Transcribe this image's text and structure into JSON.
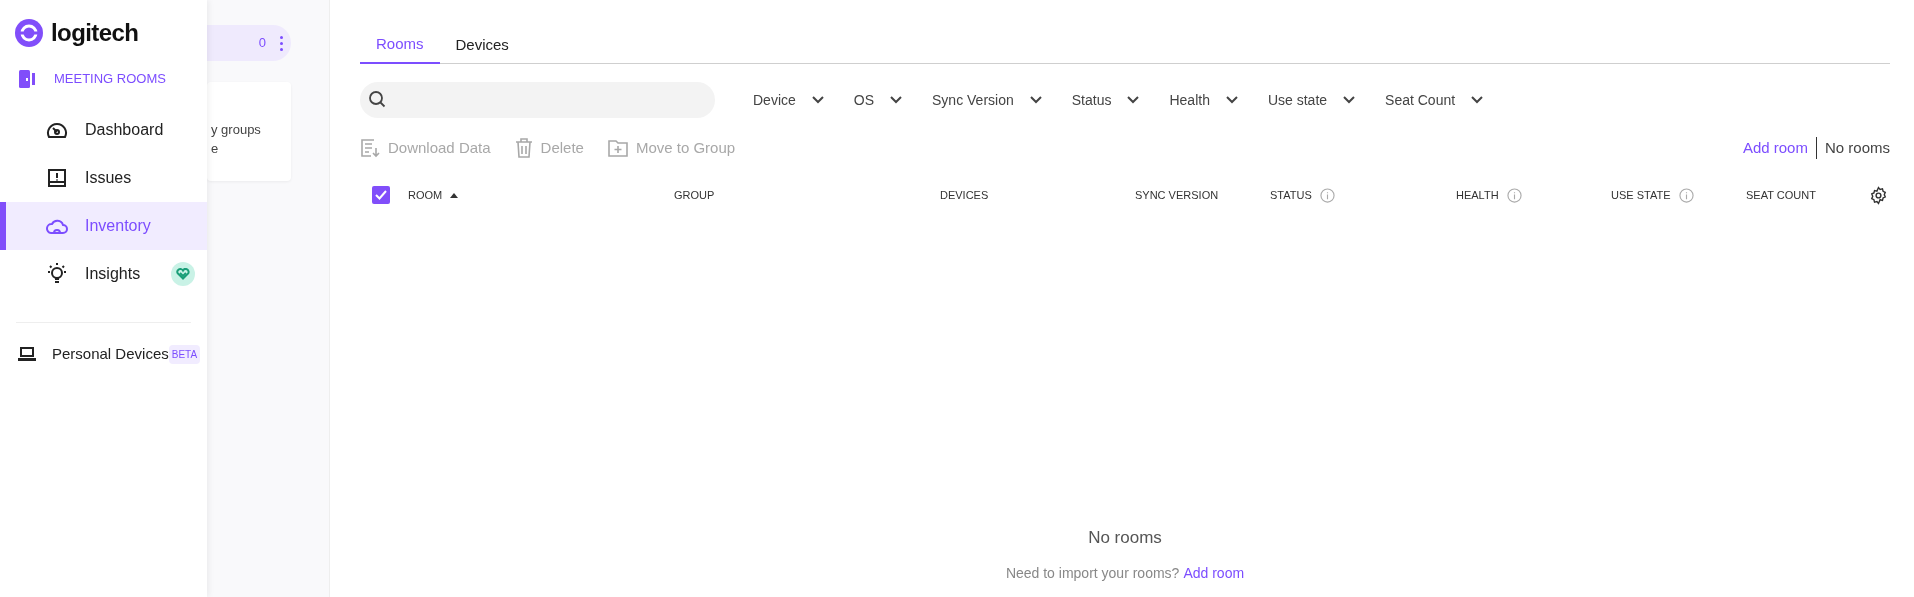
{
  "brand": {
    "name": "logitech"
  },
  "sidebar": {
    "section": {
      "label": "MEETING ROOMS"
    },
    "items": [
      {
        "label": "Dashboard",
        "selected": false,
        "badge": false
      },
      {
        "label": "Issues",
        "selected": false,
        "badge": false
      },
      {
        "label": "Inventory",
        "selected": true,
        "badge": false
      },
      {
        "label": "Insights",
        "selected": false,
        "badge": true
      }
    ],
    "footer_item": {
      "label": "Personal Devices",
      "badge": "BETA"
    }
  },
  "groups_panel": {
    "count": "0",
    "popover_lines": [
      "y groups",
      "e"
    ]
  },
  "tabs": [
    {
      "label": "Rooms",
      "selected": true
    },
    {
      "label": "Devices",
      "selected": false
    }
  ],
  "filters": [
    "Device",
    "OS",
    "Sync Version",
    "Status",
    "Health",
    "Use state",
    "Seat Count"
  ],
  "actions": [
    {
      "label": "Download Data",
      "disabled": true
    },
    {
      "label": "Delete",
      "disabled": true
    },
    {
      "label": "Move to Group",
      "disabled": true
    }
  ],
  "add_room_link": "Add room",
  "room_count": "No rooms",
  "table": {
    "select_all_checked": true,
    "columns": [
      {
        "label": "ROOM",
        "sorted": true,
        "info": false
      },
      {
        "label": "GROUP",
        "sorted": false,
        "info": false
      },
      {
        "label": "DEVICES",
        "sorted": false,
        "info": false
      },
      {
        "label": "SYNC VERSION",
        "sorted": false,
        "info": false
      },
      {
        "label": "STATUS",
        "sorted": false,
        "info": true
      },
      {
        "label": "HEALTH",
        "sorted": false,
        "info": true
      },
      {
        "label": "USE STATE",
        "sorted": false,
        "info": true
      },
      {
        "label": "SEAT COUNT",
        "sorted": false,
        "info": false
      }
    ]
  },
  "empty_state": {
    "title": "No rooms",
    "message": "Need to import your rooms?",
    "link": "Add room"
  }
}
